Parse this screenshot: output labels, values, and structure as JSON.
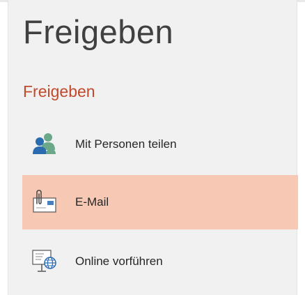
{
  "page": {
    "title": "Freigeben"
  },
  "section": {
    "title": "Freigeben"
  },
  "items": [
    {
      "label": "Mit Personen teilen",
      "icon": "people-icon",
      "selected": false
    },
    {
      "label": "E-Mail",
      "icon": "email-attachment-icon",
      "selected": true
    },
    {
      "label": "Online vorführen",
      "icon": "present-online-icon",
      "selected": false
    }
  ],
  "colors": {
    "accent": "#c24a2c",
    "selected_bg": "#f7c8b3",
    "panel_bg": "#f1f1f1",
    "title_text": "#404040"
  }
}
